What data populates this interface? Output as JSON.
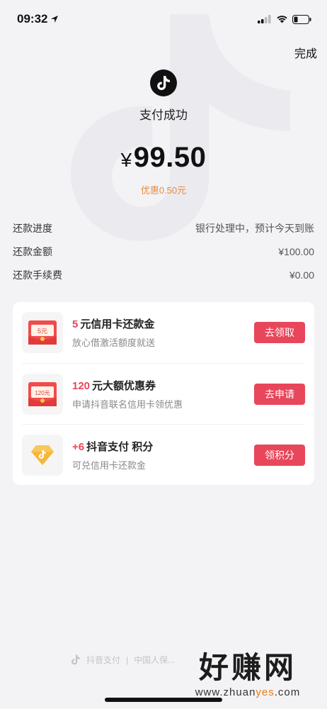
{
  "status_bar": {
    "time": "09:32"
  },
  "header": {
    "done_label": "完成"
  },
  "payment": {
    "status": "支付成功",
    "currency": "¥",
    "amount": "99.50",
    "discount": "优惠0.50元"
  },
  "details": [
    {
      "label": "还款进度",
      "value": "银行处理中，预计今天到账"
    },
    {
      "label": "还款金额",
      "value": "¥100.00"
    },
    {
      "label": "还款手续费",
      "value": "¥0.00"
    }
  ],
  "promos": [
    {
      "num": "5",
      "title": "元信用卡还款金",
      "sub": "放心借激活额度就送",
      "button": "去领取",
      "icon_text": "5元",
      "icon": "red-envelope-icon"
    },
    {
      "num": "120",
      "title": "元大额优惠券",
      "sub": "申请抖音联名信用卡领优惠",
      "button": "去申请",
      "icon_text": "120元",
      "icon": "red-envelope-icon"
    },
    {
      "num": "+6",
      "title": "抖音支付 积分",
      "sub": "可兑信用卡还款金",
      "button": "领积分",
      "icon": "diamond-points-icon"
    }
  ],
  "footer": {
    "brand": "抖音支付",
    "partner": "中国人保..."
  },
  "watermark": {
    "main": "好赚网",
    "sub_prefix": "www.zhuan",
    "sub_highlight": "yes",
    "sub_suffix": ".com"
  },
  "colors": {
    "accent": "#e8465a",
    "discount": "#e88a3d",
    "background": "#f3f3f6"
  }
}
